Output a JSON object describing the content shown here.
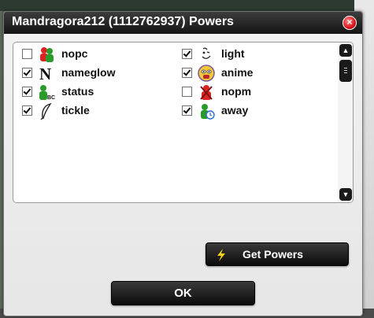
{
  "dialog": {
    "title": "Mandragora212 (1112762937) Powers",
    "close_label": "×"
  },
  "powers": [
    {
      "label": "nopc",
      "checked": false,
      "icon": "two-users-icon"
    },
    {
      "label": "nameglow",
      "checked": true,
      "icon": "letter-n-icon"
    },
    {
      "label": "status",
      "checked": true,
      "icon": "user-abc-icon"
    },
    {
      "label": "tickle",
      "checked": true,
      "icon": "feather-icon"
    },
    {
      "label": "light",
      "checked": true,
      "icon": "winking-face-icon"
    },
    {
      "label": "anime",
      "checked": true,
      "icon": "anime-face-icon"
    },
    {
      "label": "nopm",
      "checked": false,
      "icon": "blocked-user-icon"
    },
    {
      "label": "away",
      "checked": true,
      "icon": "user-clock-icon"
    }
  ],
  "buttons": {
    "get_powers": "Get Powers",
    "ok": "OK"
  },
  "colors": {
    "titlebar": "#1c1c1c",
    "close": "#d8141b",
    "bolt": "#f2d21b"
  }
}
